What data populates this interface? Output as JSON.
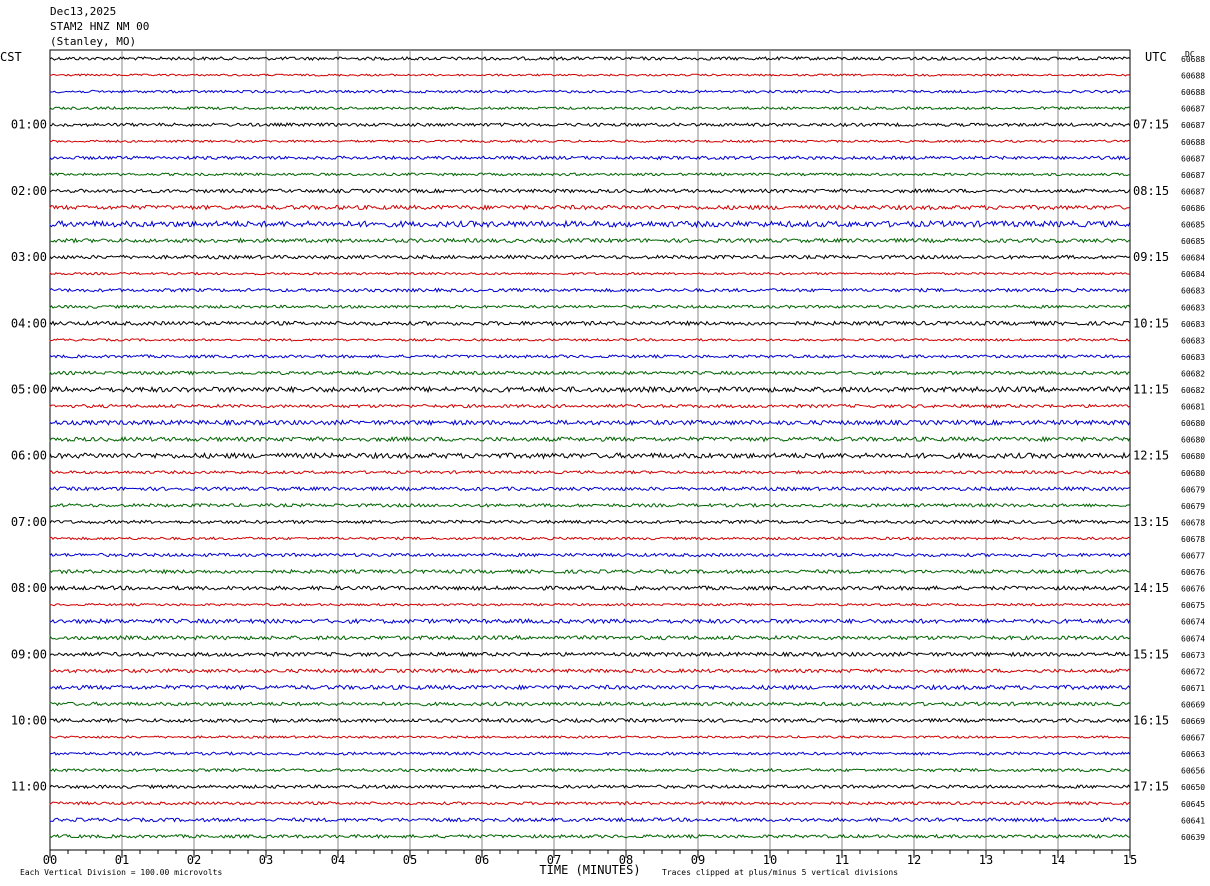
{
  "header": {
    "date": "Dec13,2025",
    "station": "STAM2 HNZ NM 00",
    "location": "(Stanley, MO)"
  },
  "chart_data": {
    "type": "line",
    "title": "Dec13,2025 STAM2 HNZ NM 00 (Stanley, MO)",
    "left_timezone_label": "CST",
    "right_timezone_label": "UTC",
    "dc_label": "DC",
    "xlabel": "TIME (MINUTES)",
    "xlim": [
      0,
      15
    ],
    "x_ticks": [
      "00",
      "01",
      "02",
      "03",
      "04",
      "05",
      "06",
      "07",
      "08",
      "09",
      "10",
      "11",
      "12",
      "13",
      "14",
      "15"
    ],
    "trace_count": 48,
    "trace_colors": [
      "#000000",
      "#d00000",
      "#0000d0",
      "#006400"
    ],
    "left_hour_labels": [
      {
        "trace": 4,
        "text": "01:00"
      },
      {
        "trace": 8,
        "text": "02:00"
      },
      {
        "trace": 12,
        "text": "03:00"
      },
      {
        "trace": 16,
        "text": "04:00"
      },
      {
        "trace": 20,
        "text": "05:00"
      },
      {
        "trace": 24,
        "text": "06:00"
      },
      {
        "trace": 28,
        "text": "07:00"
      },
      {
        "trace": 32,
        "text": "08:00"
      },
      {
        "trace": 36,
        "text": "09:00"
      },
      {
        "trace": 40,
        "text": "10:00"
      },
      {
        "trace": 44,
        "text": "11:00"
      }
    ],
    "right_hour_labels": [
      {
        "trace": 4,
        "text": "07:15"
      },
      {
        "trace": 8,
        "text": "08:15"
      },
      {
        "trace": 12,
        "text": "09:15"
      },
      {
        "trace": 16,
        "text": "10:15"
      },
      {
        "trace": 20,
        "text": "11:15"
      },
      {
        "trace": 24,
        "text": "12:15"
      },
      {
        "trace": 28,
        "text": "13:15"
      },
      {
        "trace": 32,
        "text": "14:15"
      },
      {
        "trace": 36,
        "text": "15:15"
      },
      {
        "trace": 40,
        "text": "16:15"
      },
      {
        "trace": 44,
        "text": "17:15"
      }
    ],
    "dc_offsets": [
      "60688",
      "60688",
      "60688",
      "60687",
      "60687",
      "60688",
      "60687",
      "60687",
      "60687",
      "60686",
      "60685",
      "60685",
      "60684",
      "60684",
      "60683",
      "60683",
      "60683",
      "60683",
      "60683",
      "60682",
      "60682",
      "60681",
      "60680",
      "60680",
      "60680",
      "60680",
      "60679",
      "60679",
      "60678",
      "60678",
      "60677",
      "60676",
      "60676",
      "60675",
      "60674",
      "60674",
      "60673",
      "60672",
      "60671",
      "60669",
      "60669",
      "60667",
      "60663",
      "60656",
      "60650",
      "60645",
      "60641",
      "60639"
    ],
    "trace_amplitude": [
      1.0,
      0.6,
      0.8,
      0.8,
      1.0,
      0.7,
      1.0,
      0.8,
      1.1,
      1.3,
      1.8,
      1.2,
      1.1,
      0.7,
      1.0,
      0.9,
      1.2,
      0.7,
      0.9,
      1.0,
      1.6,
      1.0,
      1.4,
      1.3,
      1.6,
      0.9,
      1.1,
      1.0,
      1.0,
      0.8,
      1.0,
      1.1,
      1.2,
      0.7,
      1.3,
      1.2,
      1.2,
      1.1,
      1.3,
      1.1,
      1.1,
      0.7,
      0.9,
      0.9,
      1.0,
      0.9,
      1.1,
      1.0
    ],
    "footer_left": "Each Vertical Division =  100.00 microvolts",
    "footer_right": "Traces clipped at plus/minus 5 vertical divisions"
  }
}
